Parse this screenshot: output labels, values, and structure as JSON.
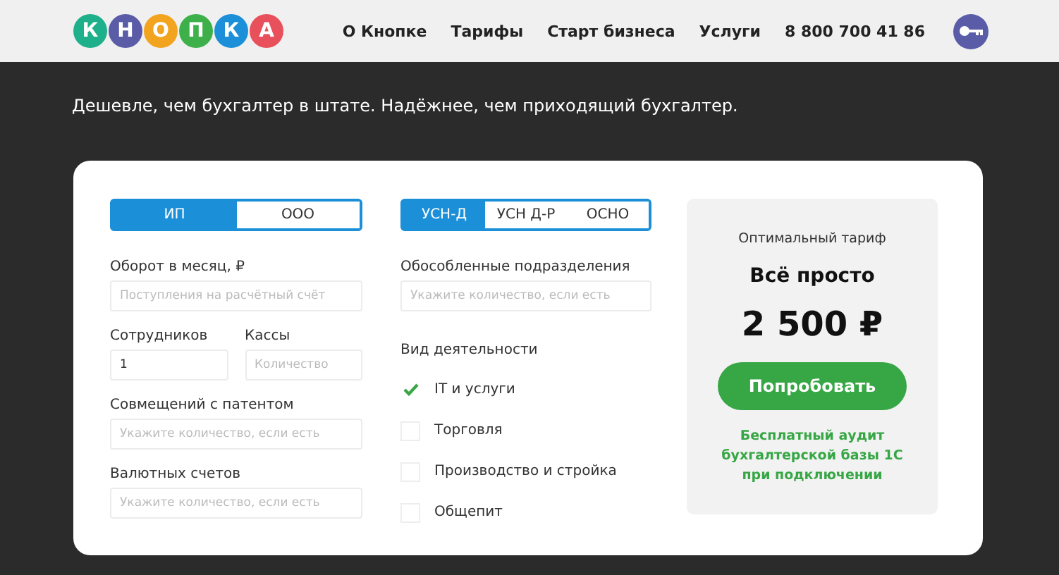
{
  "logo": {
    "letters": [
      {
        "char": "К",
        "color": "#1db08a"
      },
      {
        "char": "Н",
        "color": "#5a5ca8"
      },
      {
        "char": "О",
        "color": "#f2a41e"
      },
      {
        "char": "П",
        "color": "#3db04a"
      },
      {
        "char": "К",
        "color": "#1b8fd8"
      },
      {
        "char": "А",
        "color": "#e8505b"
      }
    ]
  },
  "nav": [
    "О Кнопке",
    "Тарифы",
    "Старт бизнеса",
    "Услуги"
  ],
  "phone": "8 800 700 41 86",
  "tagline": "Дешевле, чем бухгалтер в штате. Надёжнее, чем приходящий бухгалтер.",
  "entity_tabs": [
    {
      "label": "ИП",
      "selected": true
    },
    {
      "label": "ООО",
      "selected": false
    }
  ],
  "tax_tabs": [
    {
      "label": "УСН-Д",
      "selected": true
    },
    {
      "label": "УСН Д-Р",
      "selected": false
    },
    {
      "label": "ОСНО",
      "selected": false
    }
  ],
  "fields_left": [
    {
      "label": "Оборот в месяц, ₽",
      "placeholder": "Поступления на расчётный счёт"
    },
    {
      "label": "Сотрудников",
      "value": "1"
    },
    {
      "label": "Кассы",
      "placeholder": "Количество"
    },
    {
      "label": "Совмещений с патентом",
      "placeholder": "Укажите количество, если есть"
    },
    {
      "label": "Валютных счетов",
      "placeholder": "Укажите количество, если есть"
    }
  ],
  "branches": {
    "label": "Обособленные подразделения",
    "placeholder": "Укажите количество, если есть"
  },
  "activity": {
    "label": "Вид деятельности",
    "options": [
      {
        "label": "IT и услуги",
        "checked": true
      },
      {
        "label": "Торговля",
        "checked": false
      },
      {
        "label": "Производство и стройка",
        "checked": false
      },
      {
        "label": "Общепит",
        "checked": false
      }
    ]
  },
  "tariff": {
    "caption": "Оптимальный тариф",
    "name": "Всё просто",
    "price": "2 500 ₽",
    "button": "Попробовать",
    "note": "Бесплатный аудит бухгалтерской базы 1С при подключении"
  }
}
